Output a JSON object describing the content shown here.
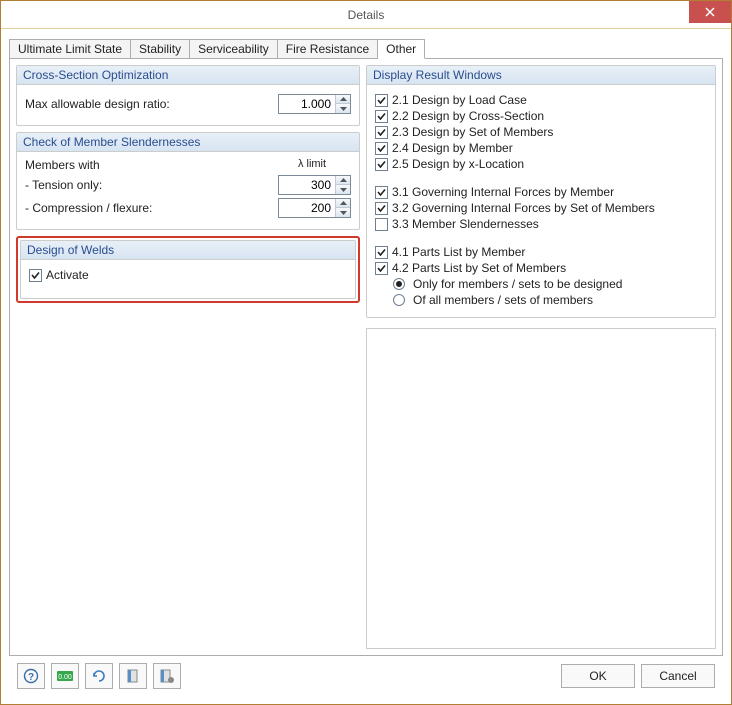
{
  "window": {
    "title": "Details"
  },
  "tabs": {
    "ultimate": "Ultimate Limit State",
    "stability": "Stability",
    "serviceability": "Serviceability",
    "fire": "Fire Resistance",
    "other": "Other"
  },
  "cross_section_opt": {
    "title": "Cross-Section Optimization",
    "max_ratio_label": "Max allowable design ratio:",
    "max_ratio_value": "1.000"
  },
  "slenderness": {
    "title": "Check of Member Slendernesses",
    "members_with": "Members with",
    "lambda_limit": "λ limit",
    "tension_label": "- Tension only:",
    "tension_value": "300",
    "compression_label": "- Compression / flexure:",
    "compression_value": "200"
  },
  "welds": {
    "title": "Design of Welds",
    "activate_label": "Activate",
    "activate_checked": true
  },
  "display_results": {
    "title": "Display Result Windows",
    "items": [
      {
        "label": "2.1 Design by Load Case",
        "checked": true
      },
      {
        "label": "2.2 Design by Cross-Section",
        "checked": true
      },
      {
        "label": "2.3 Design by Set of Members",
        "checked": true
      },
      {
        "label": "2.4 Design by Member",
        "checked": true
      },
      {
        "label": "2.5 Design by x-Location",
        "checked": true
      }
    ],
    "governing": [
      {
        "label": "3.1 Governing Internal Forces by Member",
        "checked": true
      },
      {
        "label": "3.2 Governing Internal Forces by Set of Members",
        "checked": true
      },
      {
        "label": "3.3 Member Slendernesses",
        "checked": false
      }
    ],
    "parts": [
      {
        "label": "4.1 Parts List by Member",
        "checked": true
      },
      {
        "label": "4.2 Parts List by Set of Members",
        "checked": true
      }
    ],
    "parts_radio": {
      "only": "Only for members / sets to be designed",
      "all": "Of all members / sets of members",
      "selected": "only"
    }
  },
  "footer": {
    "ok": "OK",
    "cancel": "Cancel"
  }
}
